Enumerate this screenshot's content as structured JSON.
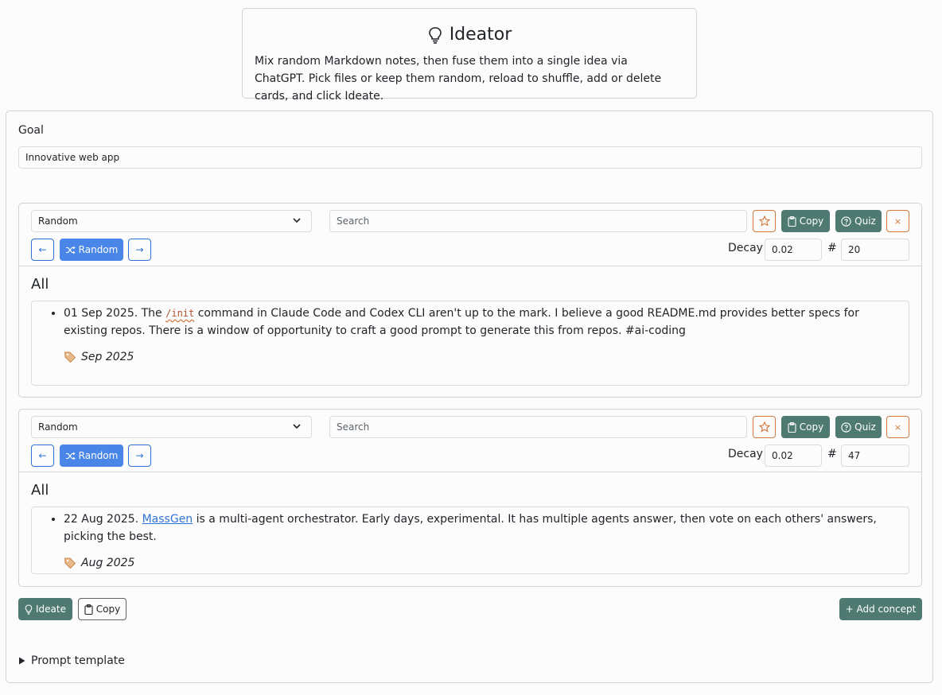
{
  "header": {
    "title": "Ideator",
    "description": "Mix random Markdown notes, then fuse them into a single idea via ChatGPT. Pick files or keep them random, reload to shuffle, add or delete cards, and click Ideate."
  },
  "goal": {
    "label": "Goal",
    "value": "Innovative web app"
  },
  "cards": [
    {
      "select_value": "Random",
      "search_placeholder": "Search",
      "copy_label": "Copy",
      "quiz_label": "Quiz",
      "close_label": "×",
      "prev_label": "←",
      "random_label": "Random",
      "next_label": "→",
      "decay_label": "Decay",
      "decay_value": "0.02",
      "count_label": "#",
      "count_value": "20",
      "section_title": "All",
      "note": {
        "date": "01 Sep 2025. The ",
        "code": "/init",
        "text": " command in Claude Code and Codex CLI aren't up to the mark. I believe a good README.md provides better specs for existing repos. There is a window of opportunity to craft a good prompt to generate this from repos. #ai-coding",
        "tag": "Sep 2025"
      }
    },
    {
      "select_value": "Random",
      "search_placeholder": "Search",
      "copy_label": "Copy",
      "quiz_label": "Quiz",
      "close_label": "×",
      "prev_label": "←",
      "random_label": "Random",
      "next_label": "→",
      "decay_label": "Decay",
      "decay_value": "0.02",
      "count_label": "#",
      "count_value": "47",
      "section_title": "All",
      "note": {
        "date": "22 Aug 2025. ",
        "link": "MassGen",
        "text": " is a multi-agent orchestrator. Early days, experimental. It has multiple agents answer, then vote on each others' answers, picking the best.",
        "tag": "Aug 2025"
      }
    }
  ],
  "actions": {
    "ideate_label": "Ideate",
    "copy_label": "Copy",
    "add_concept_label": "+ Add concept"
  },
  "prompt_template": {
    "label": "Prompt template"
  },
  "colors": {
    "accent": "#4e7a72",
    "primary": "#4a86e8",
    "warning": "#d0783a"
  }
}
